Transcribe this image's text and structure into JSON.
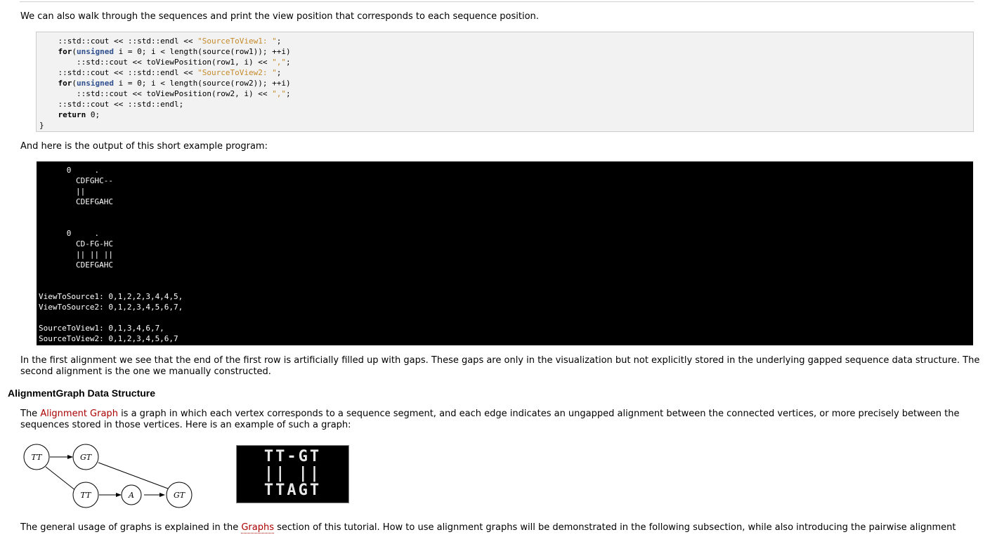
{
  "intro_text": "We can also walk through the sequences and print the view position that corresponds to each sequence position.",
  "code": {
    "line1": {
      "a": "    ::std::cout << ::std::endl << ",
      "s": "\"SourceToView1: \"",
      "b": ";"
    },
    "line2": {
      "kw": "for",
      "a": "(",
      "type": "unsigned",
      "b": " i = 0; i < length(source(row1)); ++i)"
    },
    "line3": {
      "a": "        ::std::cout << toViewPosition(row1, i) << ",
      "s": "\",\"",
      "b": ";"
    },
    "line4": {
      "a": "    ::std::cout << ::std::endl << ",
      "s": "\"SourceToView2: \"",
      "b": ";"
    },
    "line5": {
      "kw": "for",
      "a": "(",
      "type": "unsigned",
      "b": " i = 0; i < length(source(row2)); ++i)"
    },
    "line6": {
      "a": "        ::std::cout << toViewPosition(row2, i) << ",
      "s": "\",\"",
      "b": ";"
    },
    "line7": "    ::std::cout << ::std::endl;",
    "line8_kw": "return",
    "line8_rest": " 0;",
    "line9": "}"
  },
  "output_intro": "And here is the output of this short example program:",
  "terminal_output": "      0     .    \n        CDFGHC--\n        ||\n        CDEFGAHC\n\n\n      0     .    \n        CD-FG-HC\n        || || ||\n        CDEFGAHC\n\n\nViewToSource1: 0,1,2,2,3,4,4,5,\nViewToSource2: 0,1,2,3,4,5,6,7,\n\nSourceToView1: 0,1,3,4,6,7,\nSourceToView2: 0,1,2,3,4,5,6,7",
  "alignment_note": "In the first alignment we see that the end of the first row is artificially filled up with gaps. These gaps are only in the visualization but not explicitly stored in the underlying gapped sequence data structure. The second alignment is the one we manually constructed.",
  "section_title": "AlignmentGraph Data Structure",
  "ag_para": {
    "before": "The ",
    "link": "Alignment Graph",
    "after": " is a graph in which each vertex corresponds to a sequence segment, and each edge indicates an ungapped alignment between the connected vertices, or more precisely between the sequences stored in those vertices. Here is an example of such a graph:"
  },
  "graph_figure": {
    "nodes": [
      "TT",
      "GT",
      "TT",
      "A",
      "GT"
    ]
  },
  "alignment_figure": {
    "row1": "TT-GT",
    "row2": "|| ||",
    "row3": "TTAGT"
  },
  "usage_para": {
    "before": "The general usage of graphs is explained in the ",
    "link": "Graphs",
    "after": " section of this tutorial. How to use alignment graphs will be demonstrated in the following subsection, while also introducing the pairwise alignment"
  }
}
